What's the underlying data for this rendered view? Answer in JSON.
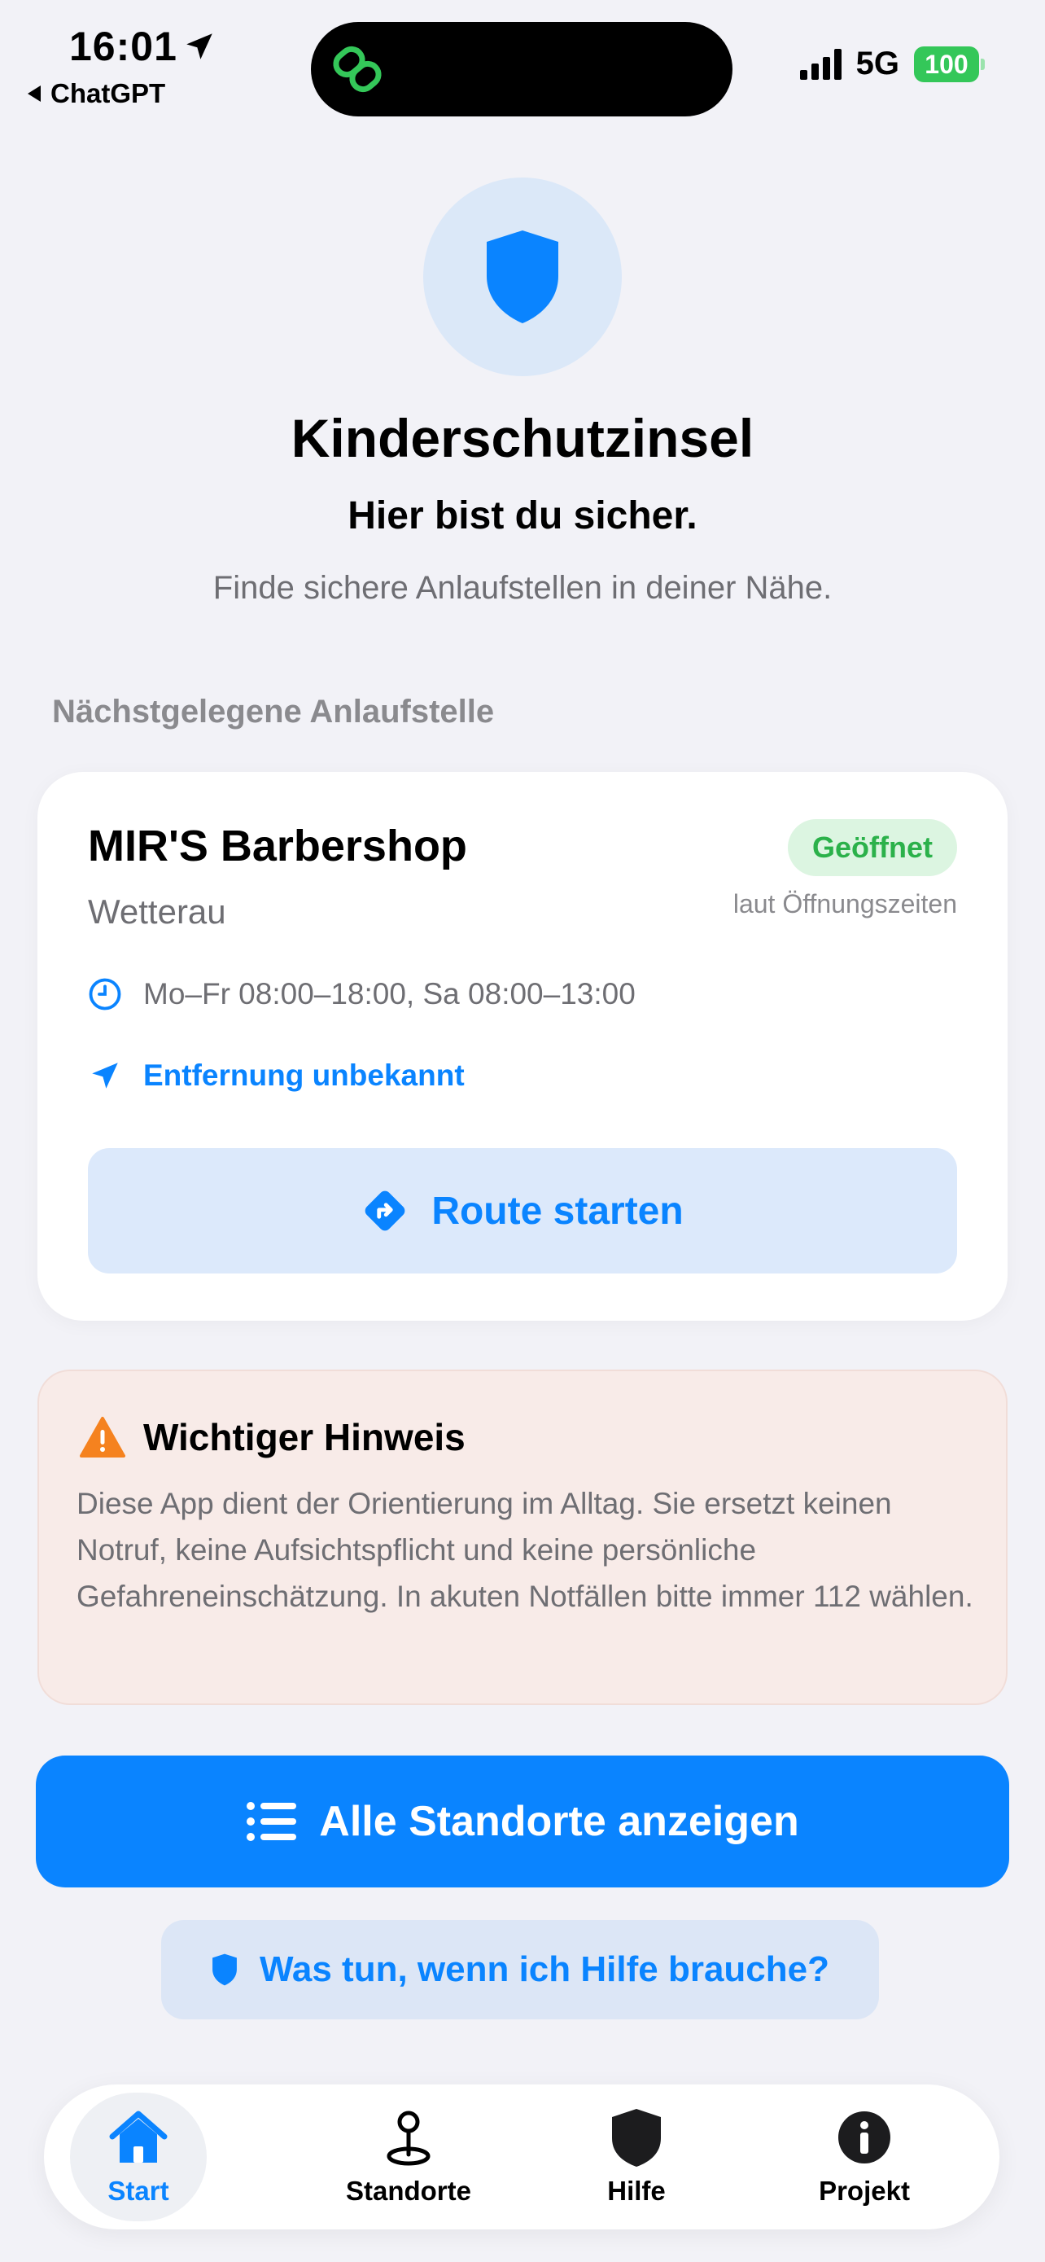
{
  "status_bar": {
    "time": "16:01",
    "back_app": "ChatGPT",
    "network": "5G",
    "battery": "100"
  },
  "hero": {
    "icon": "shield-icon",
    "title": "Kinderschutzinsel",
    "tagline": "Hier bist du sicher.",
    "subtitle": "Finde sichere Anlaufstellen in deiner Nähe."
  },
  "section_label": "Nächstgelegene Anlaufstelle",
  "nearest": {
    "name": "MIR'S Barbershop",
    "region": "Wetterau",
    "status": "Geöffnet",
    "status_note": "laut Öffnungszeiten",
    "hours": "Mo–Fr 08:00–18:00, Sa 08:00–13:00",
    "distance": "Entfernung unbekannt",
    "route_button": "Route starten"
  },
  "notice": {
    "title": "Wichtiger Hinweis",
    "body": "Diese App dient der Orientierung im Alltag. Sie ersetzt keinen Notruf, keine Aufsichtspflicht und keine persönliche Gefahreneinschätzung. In akuten Notfällen bitte immer 112 wählen."
  },
  "actions": {
    "all_locations": "Alle Standorte anzeigen",
    "help": "Was tun, wenn ich Hilfe brauche?"
  },
  "tabs": [
    {
      "label": "Start",
      "icon": "home-icon",
      "active": true
    },
    {
      "label": "Standorte",
      "icon": "map-pin-icon",
      "active": false
    },
    {
      "label": "Hilfe",
      "icon": "shield-icon",
      "active": false
    },
    {
      "label": "Projekt",
      "icon": "info-icon",
      "active": false
    }
  ],
  "colors": {
    "accent": "#0a84ff",
    "open_green": "#2bb14a",
    "warning_orange": "#f5821f",
    "background": "#f2f2f7"
  }
}
